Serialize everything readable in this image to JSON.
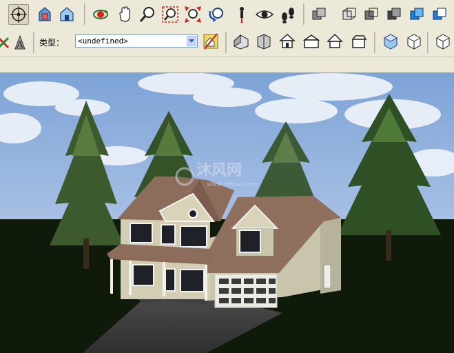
{
  "toolbar": {
    "type_label": "类型：",
    "type_value": "<undefined>"
  },
  "viewport": {
    "watermark_text": "沐风网",
    "watermark_url": "www.mfcad.com"
  },
  "colors": {
    "ui_background": "#ece9d8",
    "sky": "#7fa6d8",
    "ground": "#0f1a0b",
    "roof": "#8c6d5c",
    "siding": "#c9c5ad"
  },
  "icons_row1": [
    "orbit-icon",
    "paint-bucket-icon",
    "component-icon",
    "rotate-icon",
    "pan-icon",
    "zoom-icon",
    "zoom-window-icon",
    "zoom-extents-icon",
    "previous-view-icon",
    "position-camera-icon",
    "look-around-icon",
    "walk-icon",
    "iso-view-icon",
    "top-view-icon",
    "front-view-icon",
    "right-view-icon",
    "back-view-icon",
    "left-view-icon"
  ],
  "icons_row2": [
    "x-ray-icon",
    "text-style-icon",
    "get-models-icon",
    "house-3d-icon",
    "box-icon",
    "house-outline-icon",
    "house-flat-icon",
    "house-simple-icon",
    "house-roof-icon",
    "shaded-cube-icon",
    "wireframe-cube-icon",
    "hidden-line-cube-icon"
  ]
}
